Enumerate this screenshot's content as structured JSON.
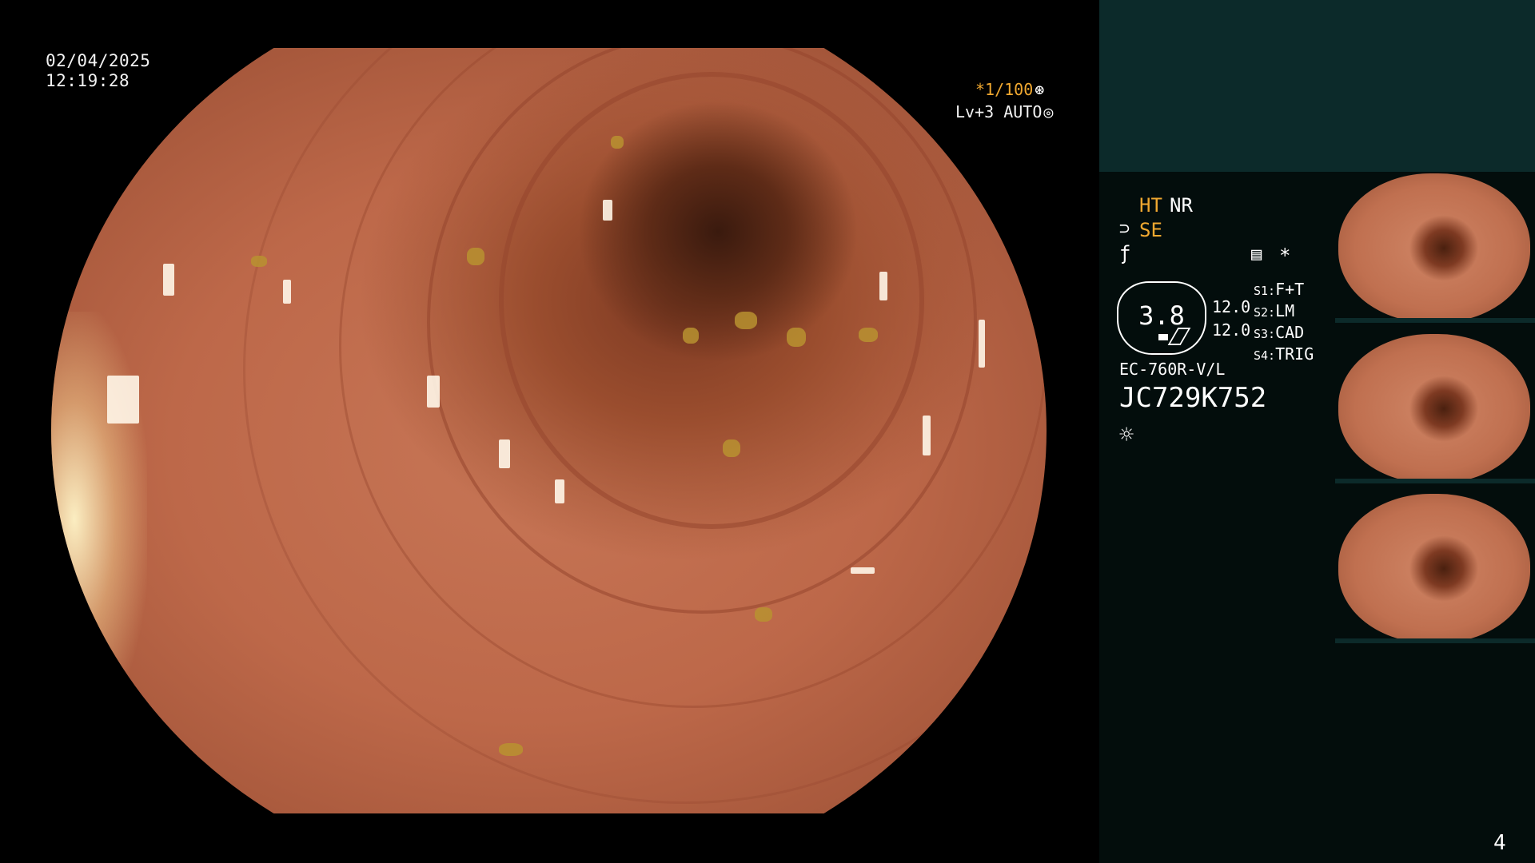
{
  "overlay": {
    "date": "02/04/2025",
    "time": "12:19:28",
    "shutter": "*1/100",
    "shutter_icon": "aperture-icon",
    "level": "Lv+3 AUTO",
    "level_icon": "iris-icon"
  },
  "panel": {
    "modes": {
      "ht": "HT",
      "nr": "NR",
      "se_icon": "⊃",
      "se": "SE",
      "f_icon": "ƒ",
      "doc_icon": "▤",
      "star_icon": "*"
    },
    "magnification": "3.8",
    "readings": [
      "12.0",
      "12.0"
    ],
    "switches": [
      {
        "label": "S1:",
        "value": "F+T"
      },
      {
        "label": "S2:",
        "value": "LM"
      },
      {
        "label": "S3:",
        "value": "CAD"
      },
      {
        "label": "S4:",
        "value": "TRIG"
      }
    ],
    "scope_model": "EC-760R-V/L",
    "scope_serial": "JC729K752",
    "light_icon": "☼"
  },
  "thumbnails": [
    {
      "name": "thumbnail-1"
    },
    {
      "name": "thumbnail-2"
    },
    {
      "name": "thumbnail-3"
    }
  ],
  "page_number": "4",
  "colors": {
    "accent_orange": "#f0a830",
    "panel_bg": "#030d0c",
    "panel_top": "#0c2a2a",
    "mucosa": "#c07050"
  }
}
